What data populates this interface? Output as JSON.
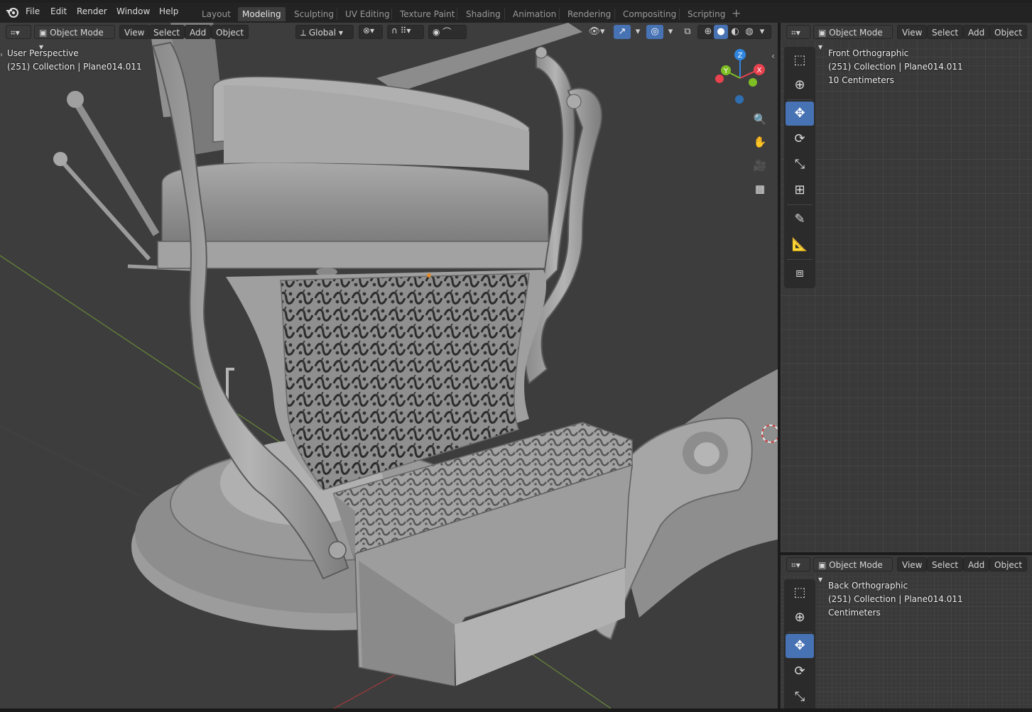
{
  "menus": [
    "File",
    "Edit",
    "Render",
    "Window",
    "Help"
  ],
  "workspaces": [
    {
      "label": "Layout",
      "active": false
    },
    {
      "label": "Modeling",
      "active": true
    },
    {
      "label": "Sculpting",
      "active": false
    },
    {
      "label": "UV Editing",
      "active": false
    },
    {
      "label": "Texture Paint",
      "active": false
    },
    {
      "label": "Shading",
      "active": false
    },
    {
      "label": "Animation",
      "active": false
    },
    {
      "label": "Rendering",
      "active": false
    },
    {
      "label": "Compositing",
      "active": false
    },
    {
      "label": "Scripting",
      "active": false
    }
  ],
  "main_viewport": {
    "mode": "Object Mode",
    "menu": [
      "View",
      "Select",
      "Add",
      "Object"
    ],
    "transform_orientation": "Global",
    "view_name": "User Perspective",
    "collection_info": "(251) Collection | Plane014.011",
    "gizmo_axes": {
      "x": "X",
      "y": "Y",
      "z": "Z"
    }
  },
  "top_right_viewport": {
    "mode": "Object Mode",
    "menu": [
      "View",
      "Select",
      "Add",
      "Object"
    ],
    "view_name": "Front Orthographic",
    "collection_info": "(251) Collection | Plane014.011",
    "scale": "10 Centimeters"
  },
  "bottom_right_viewport": {
    "mode": "Object Mode",
    "menu": [
      "View",
      "Select",
      "Add",
      "Object"
    ],
    "view_name": "Back Orthographic",
    "collection_info": "(251) Collection | Plane014.011",
    "scale": "Centimeters"
  },
  "colors": {
    "accent": "#4772b3",
    "x_axis": "#e8424f",
    "y_axis": "#7fbf23",
    "z_axis": "#2f86e0",
    "viewport_bg": "#3d3d3d"
  },
  "tools": [
    "select-box",
    "cursor",
    "move",
    "rotate",
    "scale",
    "transform",
    "annotate",
    "measure",
    "add-cube"
  ]
}
